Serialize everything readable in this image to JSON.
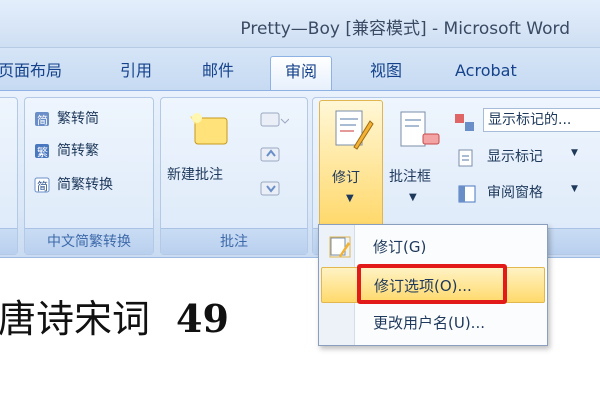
{
  "window": {
    "title": "Pretty—Boy [兼容模式] - Microsoft Word"
  },
  "tabs": [
    {
      "label": "页面布局"
    },
    {
      "label": "引用"
    },
    {
      "label": "邮件"
    },
    {
      "label": "审阅"
    },
    {
      "label": "视图"
    },
    {
      "label": "Acrobat"
    }
  ],
  "ribbon": {
    "chinese_group": {
      "label": "中文简繁转换",
      "items": [
        "繁转简",
        "简转繁",
        "简繁转换"
      ]
    },
    "comments_group": {
      "label": "批注",
      "new_comment": "新建批注"
    },
    "tracking_group": {
      "revision": "修订",
      "balloon": "批注框",
      "show_markup_select": "显示标记的...",
      "show_markup": "显示标记",
      "review_pane": "审阅窗格"
    }
  },
  "menu": {
    "items": [
      {
        "label": "修订(G)",
        "highlighted": false
      },
      {
        "label": "修订选项(O)...",
        "highlighted": true
      },
      {
        "label": "更改用户名(U)...",
        "highlighted": false
      }
    ]
  },
  "document": {
    "text": "唐诗宋词",
    "number": "49"
  },
  "colors": {
    "accent_highlight": "#ffd96b",
    "annotation_red": "#e21a1a",
    "ribbon_blue": "#dbe8f8"
  }
}
